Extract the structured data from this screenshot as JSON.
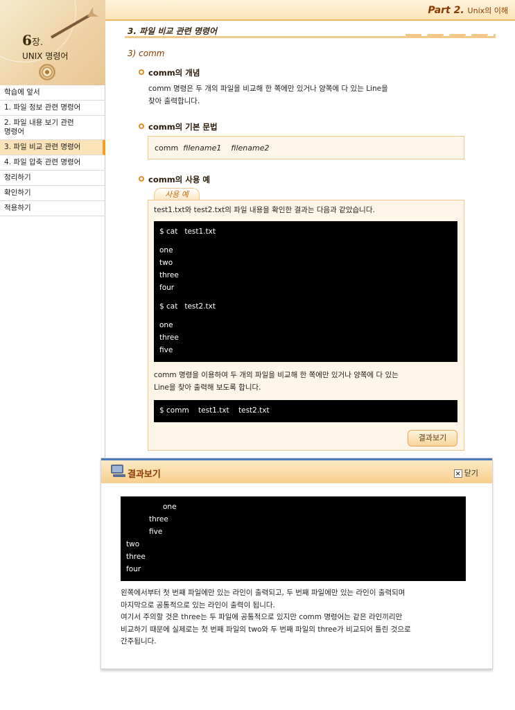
{
  "header": {
    "part": "Part 2.",
    "part_sub": "Unix의 이해"
  },
  "sidebar": {
    "chapter_num": "6",
    "chapter_suffix": "장.",
    "chapter_title": "UNIX 명령어",
    "items": [
      {
        "label": "학습에 앞서"
      },
      {
        "label": "1. 파일 정보 관련 명령어"
      },
      {
        "label": "2. 파일 내용 보기 관련\n    명령어"
      },
      {
        "label": "3. 파일 비교 관련 명령어"
      },
      {
        "label": "4. 파일 압축 관련 명령어"
      },
      {
        "label": "정리하기"
      },
      {
        "label": "확인하기"
      },
      {
        "label": "적용하기"
      }
    ]
  },
  "main": {
    "section_title": "3. 파일 비교 관련 명령어",
    "subsection": "3) comm",
    "concept": {
      "heading": "comm의 개념",
      "line1": "comm 명령은 두 개의 파일을 비교해 한 쪽에만 있거나 양쪽에 다 있는 Line을",
      "line2": "찾아 출력합니다."
    },
    "syntax": {
      "heading": "comm의 기본 문법",
      "cmd": "comm",
      "arg1": "filename1",
      "arg2": "filename2"
    },
    "example": {
      "heading": "comm의 사용 예",
      "tab": "사용 예",
      "intro": "test1.txt와 test2.txt의 파일 내용을 확인한 결과는 다음과 같았습니다.",
      "terminal": {
        "cmd1": "$ cat   test1.txt",
        "file1": [
          "one",
          "two",
          "three",
          "four"
        ],
        "cmd2": "$ cat   test2.txt",
        "file2": [
          "one",
          "three",
          "five"
        ]
      },
      "explain_line1": "comm 명령을 이용하여 두 개의 파일을 비교해 한 쪽에만 있거나 양쪽에 다 있는",
      "explain_line2": "Line을 찾아 출력해 보도록 합니다.",
      "comm_cmd": "$ comm    test1.txt    test2.txt",
      "result_button": "결과보기"
    }
  },
  "popup": {
    "title": "결과보기",
    "close_label": "닫기",
    "output": [
      {
        "col": 3,
        "text": "one"
      },
      {
        "col": 2,
        "text": "three"
      },
      {
        "col": 2,
        "text": "five"
      },
      {
        "col": 1,
        "text": "two"
      },
      {
        "col": 1,
        "text": "three"
      },
      {
        "col": 1,
        "text": "four"
      }
    ],
    "desc": [
      "왼쪽에서부터 첫 번째 파일에만 있는 라인이 출력되고, 두 번째 파일에만 있는 라인이 출력되며",
      "마지막으로 공통적으로 있는 라인이 출력이 됩니다.",
      "여기서 주의할 것은 three는 두 파일에 공통적으로 있지만 comm 명령어는 같은 라인끼리만",
      "비교하기 때문에 실제로는 첫 번째 파일의 two와 두 번째 파일의 three가 비교되어 틀린 것으로",
      "간주됩니다."
    ]
  }
}
